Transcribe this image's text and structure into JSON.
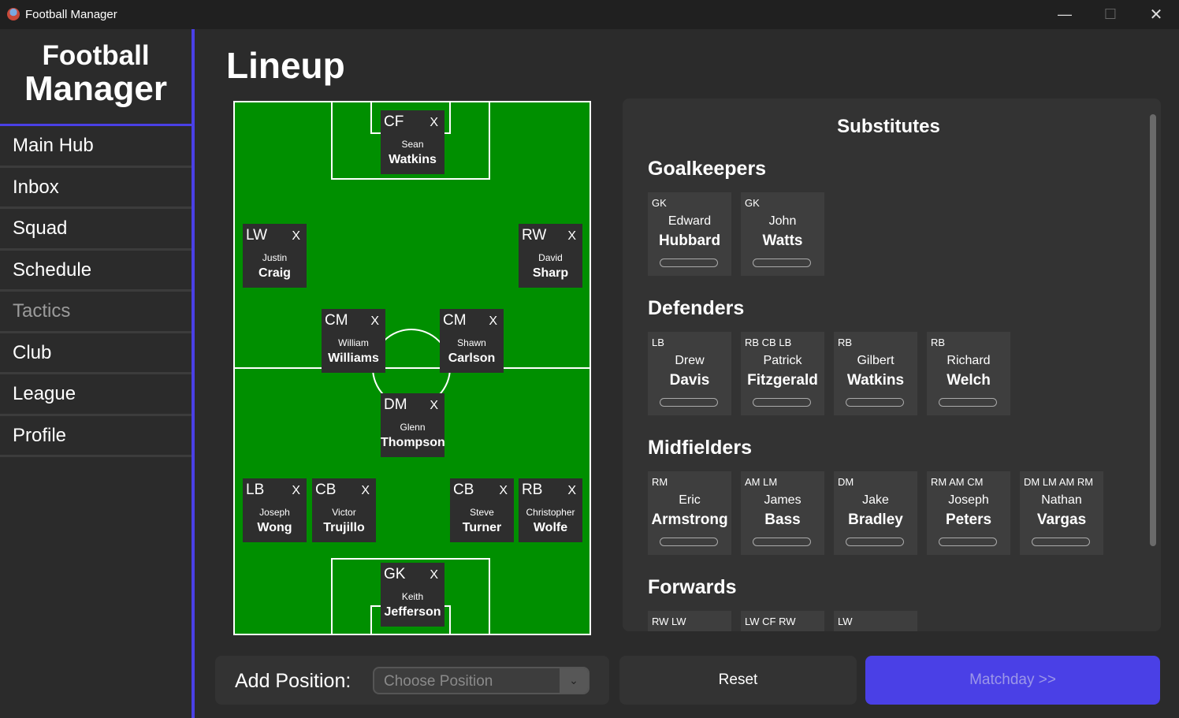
{
  "window": {
    "title": "Football Manager",
    "minimize": "—",
    "maximize": "☐",
    "close": "✕"
  },
  "sidebar": {
    "brand_line1": "Football",
    "brand_line2": "Manager",
    "items": [
      {
        "label": "Main Hub",
        "enabled": true
      },
      {
        "label": "Inbox",
        "enabled": true
      },
      {
        "label": "Squad",
        "enabled": true
      },
      {
        "label": "Schedule",
        "enabled": true
      },
      {
        "label": "Tactics",
        "enabled": false
      },
      {
        "label": "Club",
        "enabled": true
      },
      {
        "label": "League",
        "enabled": true
      },
      {
        "label": "Profile",
        "enabled": true
      }
    ]
  },
  "page_title": "Lineup",
  "lineup": [
    {
      "pos": "CF",
      "first": "Sean",
      "last": "Watkins",
      "remove": "X"
    },
    {
      "pos": "LW",
      "first": "Justin",
      "last": "Craig",
      "remove": "X"
    },
    {
      "pos": "RW",
      "first": "David",
      "last": "Sharp",
      "remove": "X"
    },
    {
      "pos": "CM",
      "first": "William",
      "last": "Williams",
      "remove": "X"
    },
    {
      "pos": "CM",
      "first": "Shawn",
      "last": "Carlson",
      "remove": "X"
    },
    {
      "pos": "DM",
      "first": "Glenn",
      "last": "Thompson",
      "remove": "X"
    },
    {
      "pos": "LB",
      "first": "Joseph",
      "last": "Wong",
      "remove": "X"
    },
    {
      "pos": "CB",
      "first": "Victor",
      "last": "Trujillo",
      "remove": "X"
    },
    {
      "pos": "CB",
      "first": "Steve",
      "last": "Turner",
      "remove": "X"
    },
    {
      "pos": "RB",
      "first": "Christopher",
      "last": "Wolfe",
      "remove": "X"
    },
    {
      "pos": "GK",
      "first": "Keith",
      "last": "Jefferson",
      "remove": "X"
    }
  ],
  "substitutes": {
    "title": "Substitutes",
    "goalkeepers": {
      "title": "Goalkeepers",
      "players": [
        {
          "pos": "GK",
          "first": "Edward",
          "last": "Hubbard"
        },
        {
          "pos": "GK",
          "first": "John",
          "last": "Watts"
        }
      ]
    },
    "defenders": {
      "title": "Defenders",
      "players": [
        {
          "pos": "LB",
          "first": "Drew",
          "last": "Davis"
        },
        {
          "pos": "RB CB LB",
          "first": "Patrick",
          "last": "Fitzgerald"
        },
        {
          "pos": "RB",
          "first": "Gilbert",
          "last": "Watkins"
        },
        {
          "pos": "RB",
          "first": "Richard",
          "last": "Welch"
        }
      ]
    },
    "midfielders": {
      "title": "Midfielders",
      "players": [
        {
          "pos": "RM",
          "first": "Eric",
          "last": "Armstrong"
        },
        {
          "pos": "AM LM",
          "first": "James",
          "last": "Bass"
        },
        {
          "pos": "DM",
          "first": "Jake",
          "last": "Bradley"
        },
        {
          "pos": "RM AM CM",
          "first": "Joseph",
          "last": "Peters"
        },
        {
          "pos": "DM LM AM RM",
          "first": "Nathan",
          "last": "Vargas"
        }
      ]
    },
    "forwards": {
      "title": "Forwards",
      "players": [
        {
          "pos": "RW LW",
          "first": "",
          "last": ""
        },
        {
          "pos": "LW CF RW",
          "first": "",
          "last": ""
        },
        {
          "pos": "LW",
          "first": "",
          "last": ""
        }
      ]
    }
  },
  "bottom": {
    "add_position_label": "Add Position:",
    "select_placeholder": "Choose Position",
    "reset_label": "Reset",
    "matchday_label": "Matchday >>"
  },
  "colors": {
    "accent": "#4a40e6",
    "pitch": "#008f00",
    "card": "#2e2e2e"
  }
}
